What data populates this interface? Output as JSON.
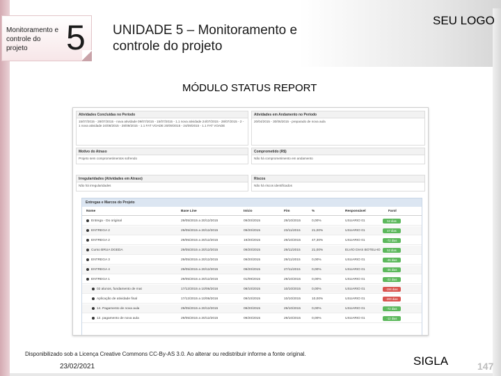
{
  "header": {
    "module_label": "Monitoramento e controle do projeto",
    "module_number": "5",
    "unit_title": "UNIDADE 5 – Monitoramento e controle do projeto",
    "logo_text": "SEU LOGO"
  },
  "section_title": "MÓDULO STATUS REPORT",
  "screenshot": {
    "panels": {
      "late_activities": {
        "title": "Atividades Concluídas no Período",
        "body": "15/07/2015 - 28/07/2015 - nova atividade 09/07/2015 - 15/07/2015 - 1.1 nova atividade 24/07/2015 - 28/07/2015 - 2 - 1 nova atividade 24/08/2015 - 28/09/2015 - 1.1 FAT VOADE 20/09/2015 - 24/09/2015 - 1.1 FAT VOADE"
      },
      "next_activities": {
        "title": "Atividades em Andamento no Período",
        "body": "20/04/2015 - 30/06/2015 - preparado de nova aula"
      },
      "reason_delay": {
        "title": "Motivo do Atraso",
        "body": "Projeto sem comprometimentos sofrendo"
      },
      "commitment": {
        "title": "Comprometido (R$)",
        "body": "Não há comprometimento em andamento"
      },
      "irregularities": {
        "title": "Irregularidades (Atividades em Atraso)",
        "body": "Não há irregularidades"
      },
      "risks": {
        "title": "Riscos",
        "body": "Não há riscos identificados"
      }
    },
    "table": {
      "title": "Entregas e Marcos do Projeto",
      "columns": [
        "Nome",
        "Base Line",
        "Início",
        "Fim",
        "%",
        "Responsável",
        "Farol"
      ],
      "rows": [
        {
          "name": "Entrega - Do original",
          "baseline": "29/05/2015 a 20/12/2015",
          "start": "09/20/2015",
          "end": "29/10/2015",
          "pct": "0,00%",
          "owner": "USUARIO 01",
          "status": "52 dias",
          "color": "#5cb85c",
          "sub": false
        },
        {
          "name": "ENTREGA 2",
          "baseline": "29/05/2015 a 20/12/2015",
          "start": "09/20/2015",
          "end": "23/11/2015",
          "pct": "21,00%",
          "owner": "USUARIO 01",
          "status": "47 dias",
          "color": "#5cb85c",
          "sub": false
        },
        {
          "name": "ENTREGA 2",
          "baseline": "29/05/2015 a 20/12/2015",
          "start": "19/20/2015",
          "end": "29/10/2015",
          "pct": "47,30%",
          "owner": "USUARIO 01",
          "status": "-72 dias",
          "color": "#5cb85c",
          "sub": false
        },
        {
          "name": "Curso BRUA DGEDA",
          "baseline": "29/05/2015 a 20/12/2015",
          "start": "09/20/2015",
          "end": "29/11/2015",
          "pct": "21,00%",
          "owner": "ELVIO DIAS BOTELHO",
          "status": "52 dias",
          "color": "#5cb85c",
          "sub": false
        },
        {
          "name": "ENTREGA 3",
          "baseline": "29/05/2015 a 20/12/2015",
          "start": "09/20/2015",
          "end": "29/11/2015",
          "pct": "0,00%",
          "owner": "USUARIO 01",
          "status": "-45 dias",
          "color": "#5cb85c",
          "sub": false
        },
        {
          "name": "ENTREGA 4",
          "baseline": "29/05/2015 a 20/12/2015",
          "start": "09/20/2015",
          "end": "27/11/2015",
          "pct": "0,00%",
          "owner": "USUARIO 01",
          "status": "-35 dias",
          "color": "#5cb85c",
          "sub": false
        },
        {
          "name": "ENTREGA 1",
          "baseline": "29/05/2015 a 20/12/2015",
          "start": "01/09/2015",
          "end": "29/10/2015",
          "pct": "0,00%",
          "owner": "USUARIO 01",
          "status": "-22 dias",
          "color": "#5cb85c",
          "sub": false
        },
        {
          "name": "02 alunos, fundamento de mat",
          "baseline": "17/12/2015 a 10/06/2016",
          "start": "08/10/2015",
          "end": "10/10/2015",
          "pct": "0,00%",
          "owner": "USUARIO 01",
          "status": "-194 dias",
          "color": "#d9534f",
          "sub": true
        },
        {
          "name": "Aplicação de atividade final",
          "baseline": "17/12/2015 a 10/06/2016",
          "start": "09/10/2015",
          "end": "10/10/2015",
          "pct": "10,00%",
          "owner": "USUARIO 01",
          "status": "-200 dias",
          "color": "#d9534f",
          "sub": true
        },
        {
          "name": "14. Pagamento de nova aula",
          "baseline": "29/05/2015 a 20/12/2015",
          "start": "09/20/2015",
          "end": "29/10/2015",
          "pct": "0,00%",
          "owner": "USUARIO 01",
          "status": "-72 dias",
          "color": "#5cb85c",
          "sub": true
        },
        {
          "name": "12. pagamento de nova aula",
          "baseline": "29/05/2015 a 20/12/2015",
          "start": "09/20/2015",
          "end": "29/10/2015",
          "pct": "0,00%",
          "owner": "USUARIO 01",
          "status": "-12 dias",
          "color": "#5cb85c",
          "sub": true
        }
      ]
    }
  },
  "footer": {
    "license": "Disponibilizado sob a Licença Creative Commons CC-By-AS 3.0. Ao alterar ou redistribuir informe a fonte original.",
    "date": "23/02/2021",
    "sigla": "SIGLA",
    "page": "147"
  },
  "colors": {
    "accent_pink": "#d4aab2",
    "status_green": "#5cb85c",
    "status_red": "#d9534f",
    "table_header_blue": "#dce6f2"
  }
}
